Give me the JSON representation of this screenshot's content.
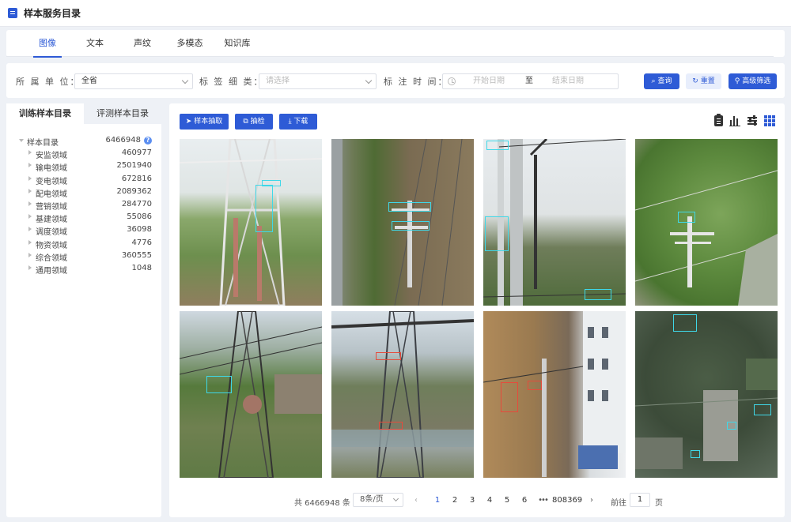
{
  "header": {
    "title": "样本服务目录",
    "icon": "document-icon"
  },
  "tabs": [
    {
      "label": "图像",
      "active": true
    },
    {
      "label": "文本",
      "active": false
    },
    {
      "label": "声纹",
      "active": false
    },
    {
      "label": "多模态",
      "active": false
    },
    {
      "label": "知识库",
      "active": false
    }
  ],
  "filters": {
    "unit_label": "所 属 单 位：",
    "unit_value": "全省",
    "tag_label": "标 签 细 类：",
    "tag_placeholder": "请选择",
    "time_label": "标 注 时 间：",
    "start_placeholder": "开始日期",
    "range_sep": "至",
    "end_placeholder": "结束日期",
    "query_button": "查询",
    "reset_button": "重置",
    "advanced_button": "高级筛选"
  },
  "left_tabs": [
    {
      "label": "训练样本目录",
      "active": true
    },
    {
      "label": "评测样本目录",
      "active": false
    }
  ],
  "tree": {
    "root": {
      "label": "样本目录",
      "count": "6466948"
    },
    "children": [
      {
        "label": "安监领域",
        "count": "460977"
      },
      {
        "label": "输电领域",
        "count": "2501940"
      },
      {
        "label": "变电领域",
        "count": "672816"
      },
      {
        "label": "配电领域",
        "count": "2089362"
      },
      {
        "label": "营销领域",
        "count": "284770"
      },
      {
        "label": "基建领域",
        "count": "55086"
      },
      {
        "label": "调度领域",
        "count": "36098"
      },
      {
        "label": "物资领域",
        "count": "4776"
      },
      {
        "label": "综合领域",
        "count": "360555"
      },
      {
        "label": "通用领域",
        "count": "1048"
      }
    ]
  },
  "toolbar": {
    "extract_button": "样本抽取",
    "check_button": "抽检",
    "download_button": "下载",
    "view_icons": [
      "clipboard-icon",
      "bar-chart-icon",
      "sliders-icon",
      "grid-view-icon"
    ]
  },
  "gallery": {
    "images": [
      {
        "name": "transmission-tower-closeup"
      },
      {
        "name": "pole-beside-road"
      },
      {
        "name": "concrete-pole-insulators"
      },
      {
        "name": "pole-in-green-field"
      },
      {
        "name": "tower-over-farmland"
      },
      {
        "name": "tower-over-river-village"
      },
      {
        "name": "distribution-pole-near-building"
      },
      {
        "name": "aerial-dark-field"
      }
    ]
  },
  "pagination": {
    "total": "共 6466948 条",
    "page_size": "8条/页",
    "pages": [
      "1",
      "2",
      "3",
      "4",
      "5",
      "6"
    ],
    "current": "1",
    "ellipsis": "•••",
    "last_page": "808369",
    "goto_label": "前往",
    "goto_value": "1",
    "goto_unit": "页"
  },
  "colors": {
    "accent": "#2e5bd6",
    "box_cyan": "#3fd8e8",
    "box_red": "#e54b3c"
  }
}
